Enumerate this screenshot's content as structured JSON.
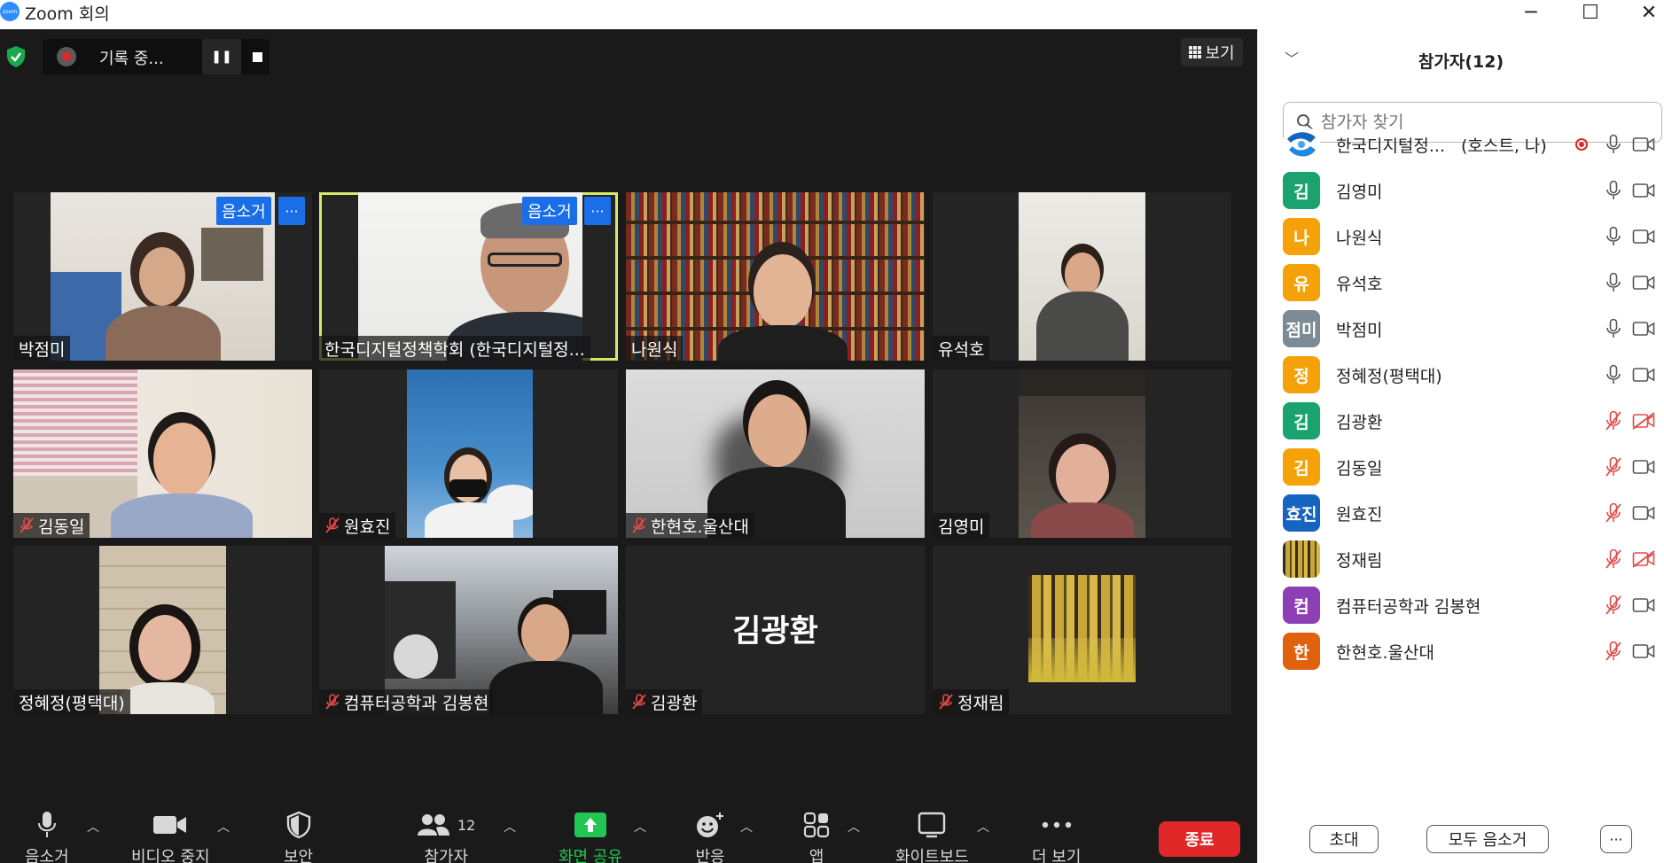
{
  "window": {
    "logo_text": "zoom",
    "title": "Zoom 회의"
  },
  "recording": {
    "label": "기록 중...",
    "pause_glyph": "❚❚"
  },
  "view_button": {
    "label": "보기"
  },
  "tiles": [
    {
      "name": "박점미",
      "muted": false
    },
    {
      "name": "한국디지털정책학회 (한국디지털정...",
      "muted": false,
      "active": true,
      "mute_label": "음소거",
      "more_label": "···"
    },
    {
      "name": "나원식",
      "muted": false
    },
    {
      "name": "유석호",
      "muted": false
    },
    {
      "name": "김동일",
      "muted": true
    },
    {
      "name": "원효진",
      "muted": true
    },
    {
      "name": "한현호.울산대",
      "muted": true
    },
    {
      "name": "김영미",
      "muted": false
    },
    {
      "name": "정혜정(평택대)",
      "muted": false
    },
    {
      "name": "컴퓨터공학과 김봉현",
      "muted": true
    },
    {
      "name": "김광환",
      "muted": true,
      "big_name": "김광환"
    },
    {
      "name": "정재림",
      "muted": true
    }
  ],
  "tile_overlay": {
    "mute_label": "음소거",
    "more_label": "···"
  },
  "toolbar": {
    "mute": "음소거",
    "video": "비디오 중지",
    "security": "보안",
    "participants": "참가자",
    "participants_count": "12",
    "share": "화면 공유",
    "reactions": "반응",
    "apps": "앱",
    "whiteboard": "화이트보드",
    "more": "더 보기",
    "end": "종료"
  },
  "panel": {
    "title": "참가자(12)",
    "search_placeholder": "참가자 찾기",
    "participants": [
      {
        "avatar": "",
        "name": "한국디지털정...",
        "role": "(호스트, 나)",
        "color": "#1565c0",
        "mic_on": true,
        "cam_on": true,
        "recording": true
      },
      {
        "avatar": "김",
        "name": "김영미",
        "color": "#1aa36f",
        "mic_on": true,
        "cam_on": true
      },
      {
        "avatar": "나",
        "name": "나원식",
        "color": "#f5a20a",
        "mic_on": true,
        "cam_on": true
      },
      {
        "avatar": "유",
        "name": "유석호",
        "color": "#f5a20a",
        "mic_on": true,
        "cam_on": true
      },
      {
        "avatar": "점미",
        "name": "박점미",
        "color": "#7b8a94",
        "mic_on": true,
        "cam_on": true
      },
      {
        "avatar": "정",
        "name": "정혜정(평택대)",
        "color": "#f5a20a",
        "mic_on": true,
        "cam_on": true
      },
      {
        "avatar": "김",
        "name": "김광환",
        "color": "#1aa36f",
        "mic_on": false,
        "cam_on": false
      },
      {
        "avatar": "김",
        "name": "김동일",
        "color": "#f5a20a",
        "mic_on": false,
        "cam_on": true
      },
      {
        "avatar": "효진",
        "name": "원효진",
        "color": "#1565c0",
        "mic_on": false,
        "cam_on": true
      },
      {
        "avatar": "",
        "name": "정재림",
        "color": "#8a6d2e",
        "mic_on": false,
        "cam_on": false
      },
      {
        "avatar": "컴",
        "name": "컴퓨터공학과 김봉현",
        "color": "#8e3fb5",
        "mic_on": false,
        "cam_on": true
      },
      {
        "avatar": "한",
        "name": "한현호.울산대",
        "color": "#e0620e",
        "mic_on": false,
        "cam_on": true
      }
    ],
    "invite": "초대",
    "mute_all": "모두 음소거",
    "more": "···"
  }
}
